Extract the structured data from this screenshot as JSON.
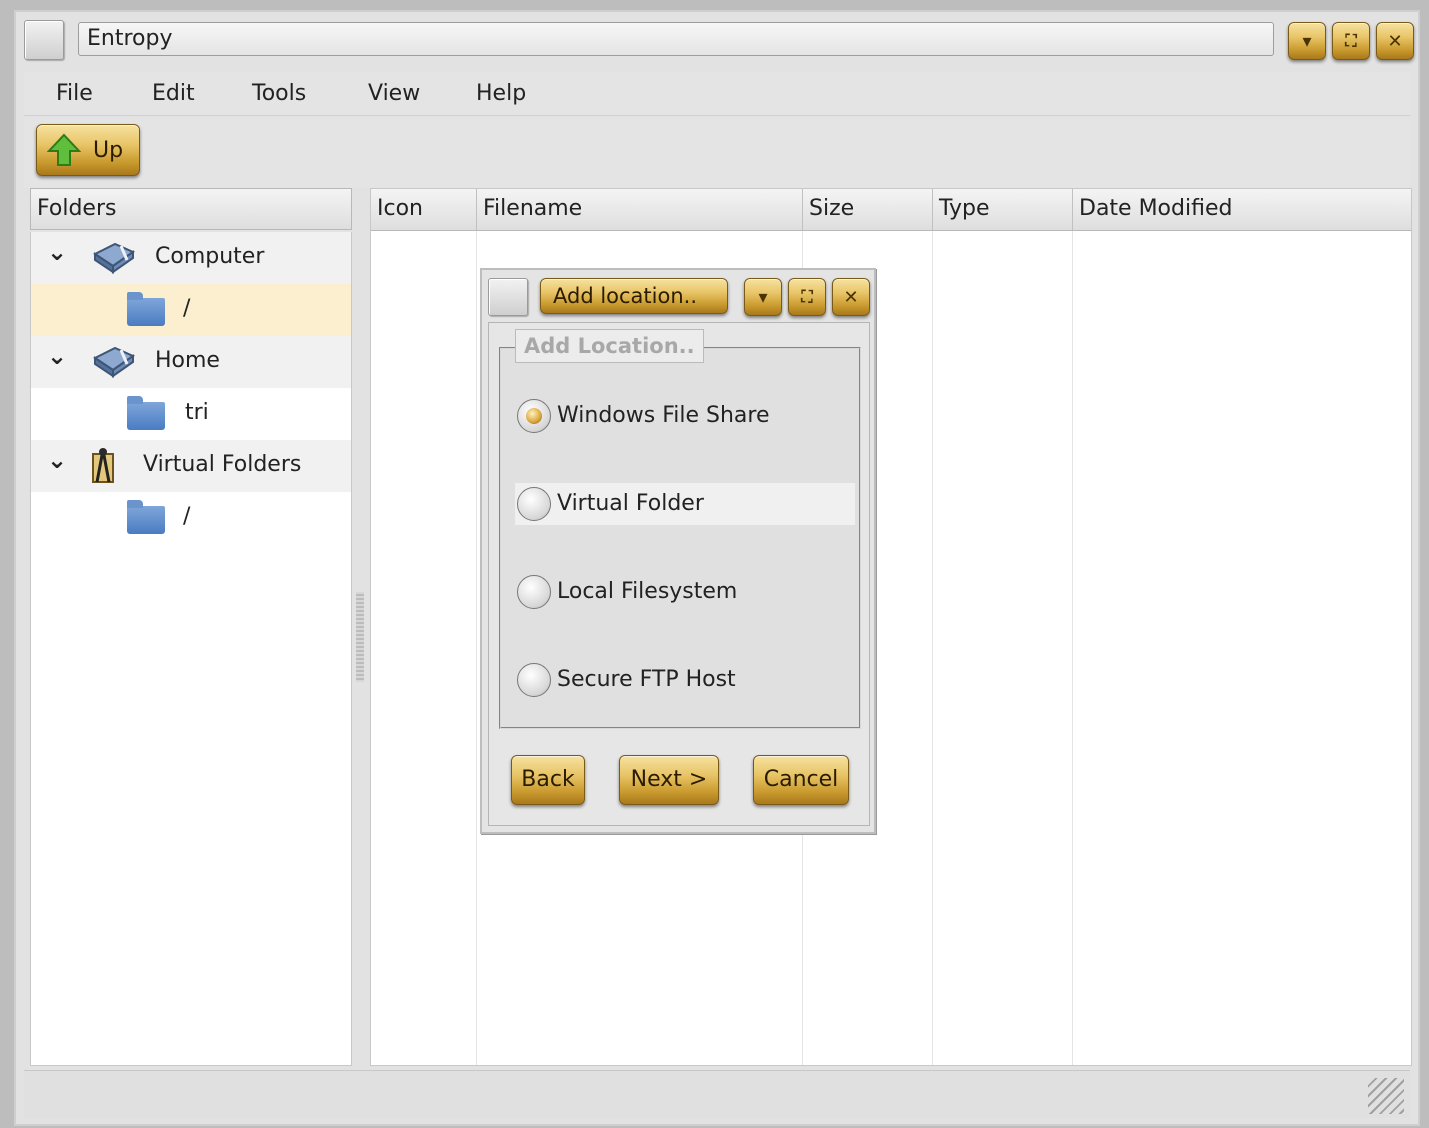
{
  "window": {
    "title": "Entropy",
    "controls": [
      "minimize",
      "maximize",
      "close"
    ]
  },
  "menubar": {
    "items": [
      "File",
      "Edit",
      "Tools",
      "View",
      "Help"
    ]
  },
  "toolbar": {
    "up_label": "Up"
  },
  "folders_panel": {
    "header": "Folders",
    "tree": [
      {
        "label": "Computer",
        "icon": "drive-icon",
        "expanded": true
      },
      {
        "label": "/",
        "icon": "folder-icon",
        "selected": true
      },
      {
        "label": "Home",
        "icon": "drive-icon",
        "expanded": true
      },
      {
        "label": "tri",
        "icon": "folder-icon"
      },
      {
        "label": "Virtual Folders",
        "icon": "virtual-folders-icon",
        "expanded": true
      },
      {
        "label": "/",
        "icon": "folder-icon"
      }
    ]
  },
  "file_list": {
    "columns": [
      "Icon",
      "Filename",
      "Size",
      "Type",
      "Date Modified"
    ]
  },
  "dialog": {
    "title": "Add location..",
    "group_title": "Add Location..",
    "options": [
      {
        "label": "Windows File Share",
        "selected": true
      },
      {
        "label": "Virtual Folder",
        "selected": false
      },
      {
        "label": "Local Filesystem",
        "selected": false
      },
      {
        "label": "Secure FTP Host",
        "selected": false
      }
    ],
    "buttons": {
      "back": "Back",
      "next": "Next >",
      "cancel": "Cancel"
    }
  },
  "colors": {
    "accent_gold": "#e8c466",
    "selection": "#fbefcf"
  }
}
